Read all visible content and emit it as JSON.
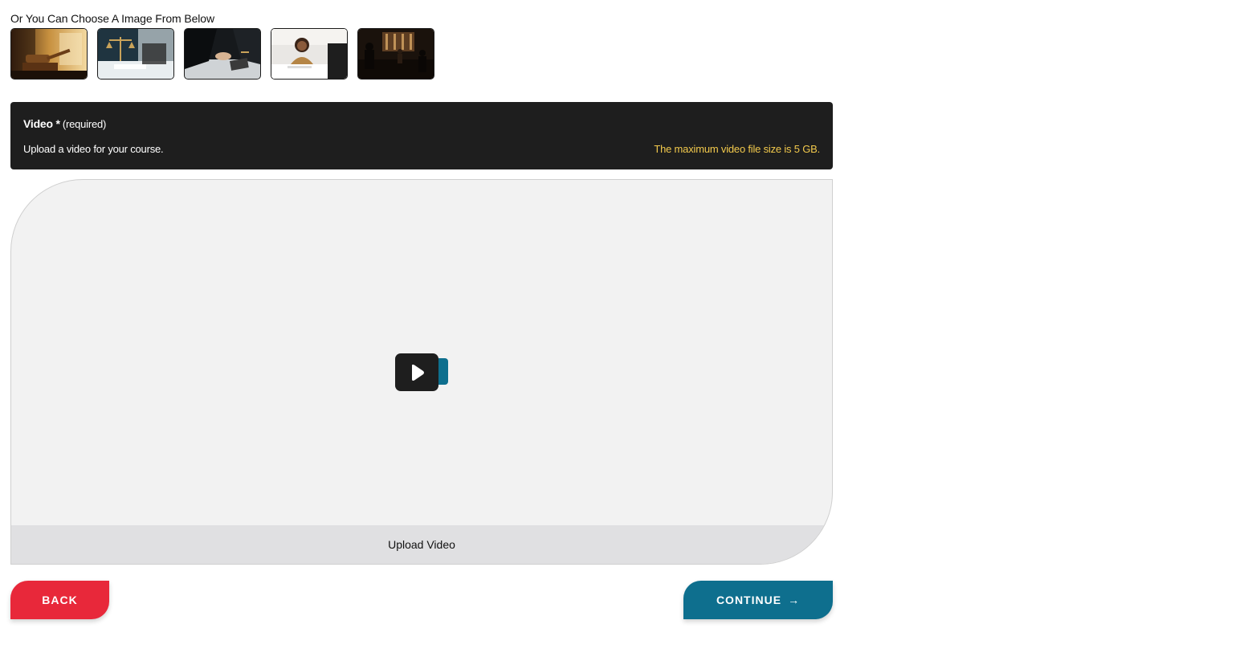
{
  "image_picker": {
    "label": "Or You Can Choose A Image From Below",
    "thumbnails": [
      {
        "name": "gavel-image"
      },
      {
        "name": "scales-of-justice-image"
      },
      {
        "name": "handshake-image"
      },
      {
        "name": "smiling-woman-meeting-image"
      },
      {
        "name": "courtroom-image"
      }
    ]
  },
  "video_section": {
    "title": "Video *",
    "required_text": "(required)",
    "description": "Upload a video for your course.",
    "max_size_note": "The maximum video file size is 5 GB.",
    "upload_label": "Upload Video",
    "icon": "video-camera-icon"
  },
  "actions": {
    "back_label": "BACK",
    "continue_label": "CONTINUE",
    "continue_icon": "→"
  },
  "colors": {
    "header_bg": "#1e1e1e",
    "warning_text": "#f2c94c",
    "back_button": "#e8283a",
    "continue_button": "#0e6f8e",
    "upload_area_bg": "#f2f2f2",
    "upload_footer_bg": "#e0e0e2"
  }
}
